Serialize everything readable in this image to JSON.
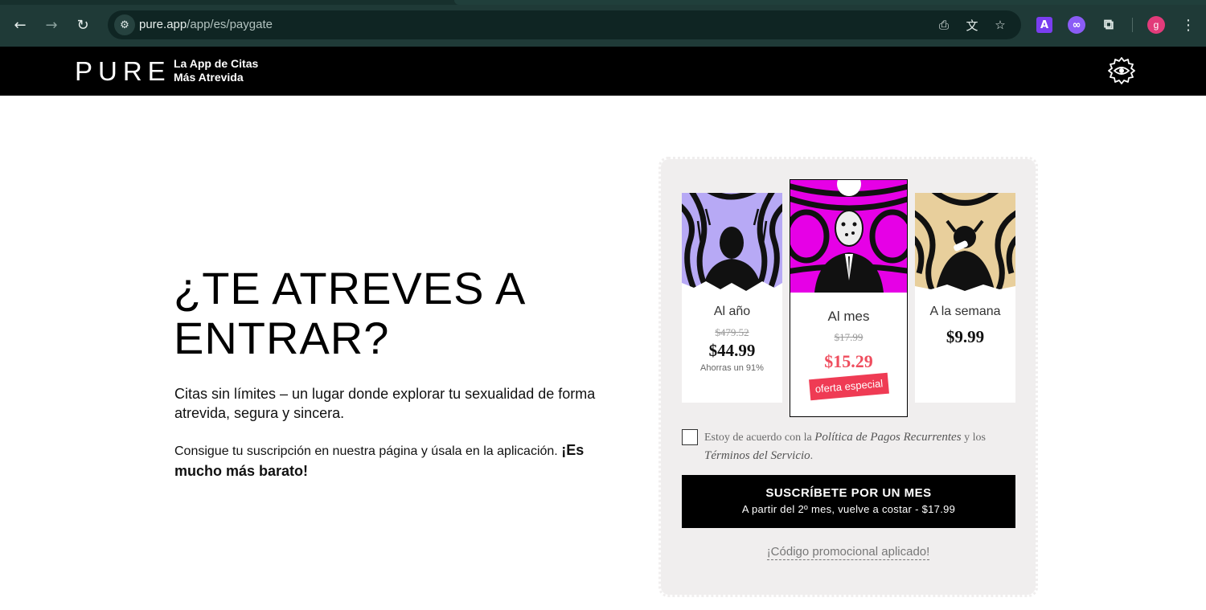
{
  "browser": {
    "url_host": "pure.app",
    "url_path": "/app/es/paygate",
    "profile_initial": "g",
    "extension_a_label": "A"
  },
  "header": {
    "logo": "PURE",
    "tagline_line1": "La App de Citas",
    "tagline_line2": "Más Atrevida"
  },
  "hero": {
    "title": "¿TE ATREVES A ENTRAR?",
    "description": "Citas sin límites – un lugar donde explorar tu sexualidad de forma atrevida, segura y sincera.",
    "cta_text": "Consigue tu suscripción en nuestra página y úsala en la aplicación.",
    "cta_bold": "¡Es mucho más barato!"
  },
  "plans": [
    {
      "name": "Al año",
      "old_price": "$479.52",
      "price": "$44.99",
      "savings": "Ahorras un 91%"
    },
    {
      "name": "Al mes",
      "old_price": "$17.99",
      "price": "$15.29",
      "badge": "oferta especial"
    },
    {
      "name": "A la semana",
      "price": "$9.99"
    }
  ],
  "agreement": {
    "prefix": "Estoy de acuerdo con la",
    "link1": "Política de Pagos Recurrentes",
    "middle": "y los",
    "link2": "Términos del Servicio",
    "suffix": "."
  },
  "subscribe": {
    "title": "SUSCRÍBETE POR UN MES",
    "subtitle": "A partir del 2º mes, vuelve a costar - $17.99"
  },
  "promo": "¡Código promocional aplicado!",
  "colors": {
    "accent_red": "#ef3b54",
    "header_bg": "#000000",
    "panel_bg": "#f0eeee",
    "art_magenta": "#e600e6",
    "art_lavender": "#b7a9f5",
    "art_tan": "#e8cf9c"
  }
}
